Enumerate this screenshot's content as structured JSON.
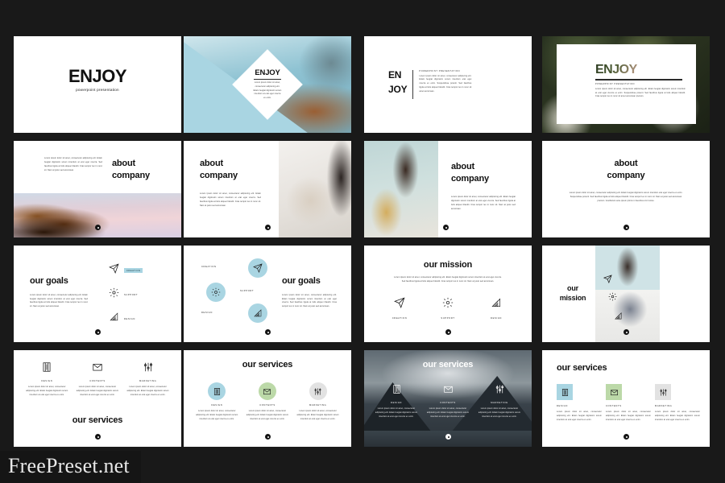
{
  "page": {
    "background_color": "#191919",
    "watermark": "FreePreset.net",
    "accent_blue": "#a9d5e2",
    "accent_green": "#bcd9a8",
    "accent_gray": "#e2e2e2",
    "text_dark": "#111111"
  },
  "lorem": {
    "short": "Lorem ipsum dolor sit amet, consectetur adipiscing elit. Etiam feugiat dignissim sorem interdum erat eget viverra ex enim. Suspendisse potenti.",
    "medium": "Lorem ipsum dolor sit amet, consectetur adipiscing elit. Etiam feugiat dignissim sorem interdum at erat eget viverra. Sed faucibus ligula at felis aliquet blandit. Cras tempor leo in nunc sit. Nam at justo sed accumsan.",
    "long": "Lorem ipsum dolor sit amet, consectetur adipiscing elit. Etiam feugiat dignissim sorem interdum erat eget viverra ex enim. Suspendisse potenti. Sed faucibus ligula at felis aliquet blandit. Cras tempor leo in nunc sit. Nam at justo sed accumsan pretium. Vestibulum ante ipsum primis in faucibus orci luctus.",
    "tiny": "Lorem ipsum dolor sit amet, consectetur adipiscing elit. Etiam feugiat dignissim sorem interdum at erat eget viverra ex enim."
  },
  "slides": [
    {
      "id": 1,
      "name": "title-plain",
      "title": "ENJOY",
      "subtitle": "powerpoint presentation"
    },
    {
      "id": 2,
      "name": "title-diamond-photo",
      "title": "ENJOY",
      "body": "Lorem ipsum dolor sit amet, consectetur adipiscing elit. Etiam feugiat dignissim sorem interdum at erat eget viverra ex enim."
    },
    {
      "id": 3,
      "name": "title-split-text",
      "title_line1": "EN",
      "title_line2": "JOY",
      "kicker": "POWERPOINT PRESENTATION",
      "body": "Lorem ipsum dolor sit amet, consectetur adipiscing elit. Etiam feugiat dignissim sorem interdum erat eget viverra ex enim. Suspendisse potenti. Sed faucibus ligula at felis aliquet blandit. Cras tempor leo in nunc sit amet accumsan."
    },
    {
      "id": 4,
      "name": "title-photo-letters",
      "title": "ENJOY",
      "kicker": "POWERPOINT PRESENTATION",
      "body": "Lorem ipsum dolor sit amet, consectetur adipiscing elit. Etiam feugiat dignissim sorem interdum at erat eget viverra ex enim. Suspendisse potenti. Sed faucibus ligula at felis aliquet blandit. Cras tempor leo in nunc sit amet accumsan pretium."
    },
    {
      "id": 5,
      "name": "about-company-horse",
      "title_line1": "about",
      "title_line2": "company"
    },
    {
      "id": 6,
      "name": "about-company-jars",
      "title_line1": "about",
      "title_line2": "company"
    },
    {
      "id": 7,
      "name": "about-company-hats",
      "title_line1": "about",
      "title_line2": "company"
    },
    {
      "id": 8,
      "name": "about-company-centered",
      "title_line1": "about",
      "title_line2": "company"
    },
    {
      "id": 9,
      "name": "our-goals-list-left",
      "title": "our goals",
      "items": [
        {
          "label": "CREATION",
          "icon": "paper-plane-icon",
          "highlight": true
        },
        {
          "label": "SUPPORT",
          "icon": "gear-icon",
          "highlight": false
        },
        {
          "label": "DESIGN",
          "icon": "pyramid-icon",
          "highlight": false
        }
      ]
    },
    {
      "id": 10,
      "name": "our-goals-circles",
      "title": "our goals",
      "items": [
        {
          "label": "CREATION",
          "icon": "paper-plane-icon"
        },
        {
          "label": "SUPPORT",
          "icon": "gear-icon"
        },
        {
          "label": "DESIGN",
          "icon": "pyramid-icon"
        }
      ]
    },
    {
      "id": 11,
      "name": "our-mission-centered",
      "title": "our mission",
      "items": [
        {
          "label": "CREATION",
          "icon": "paper-plane-icon"
        },
        {
          "label": "SUPPORT",
          "icon": "gear-icon"
        },
        {
          "label": "DESIGN",
          "icon": "pyramid-icon"
        }
      ]
    },
    {
      "id": 12,
      "name": "our-mission-photo",
      "title_line1": "our",
      "title_line2": "mission"
    },
    {
      "id": 13,
      "name": "our-services-bottom-title",
      "title": "our services",
      "items": [
        {
          "label": "DESIGN",
          "icon": "book-icon"
        },
        {
          "label": "CONTENTS",
          "icon": "envelope-icon"
        },
        {
          "label": "MARKETING",
          "icon": "sliders-icon"
        }
      ]
    },
    {
      "id": 14,
      "name": "our-services-circles",
      "title": "our services",
      "items": [
        {
          "label": "DESIGN",
          "icon": "book-icon",
          "color": "#a9d5e2"
        },
        {
          "label": "CONTENTS",
          "icon": "envelope-icon",
          "color": "#bcd9a8"
        },
        {
          "label": "MARKETING",
          "icon": "sliders-icon",
          "color": "#e2e2e2"
        }
      ]
    },
    {
      "id": 15,
      "name": "our-services-photo-dark",
      "title": "our services",
      "items": [
        {
          "label": "DESIGN",
          "icon": "book-icon"
        },
        {
          "label": "CONTENTS",
          "icon": "envelope-icon"
        },
        {
          "label": "MARKETING",
          "icon": "sliders-icon"
        }
      ]
    },
    {
      "id": 16,
      "name": "our-services-squares",
      "title": "our services",
      "items": [
        {
          "label": "DESIGN",
          "icon": "book-icon",
          "color": "#a9d5e2"
        },
        {
          "label": "CONTENTS",
          "icon": "envelope-icon",
          "color": "#bcd9a8"
        },
        {
          "label": "MARKETING",
          "icon": "sliders-icon",
          "color": "#e2e2e2"
        }
      ]
    }
  ]
}
